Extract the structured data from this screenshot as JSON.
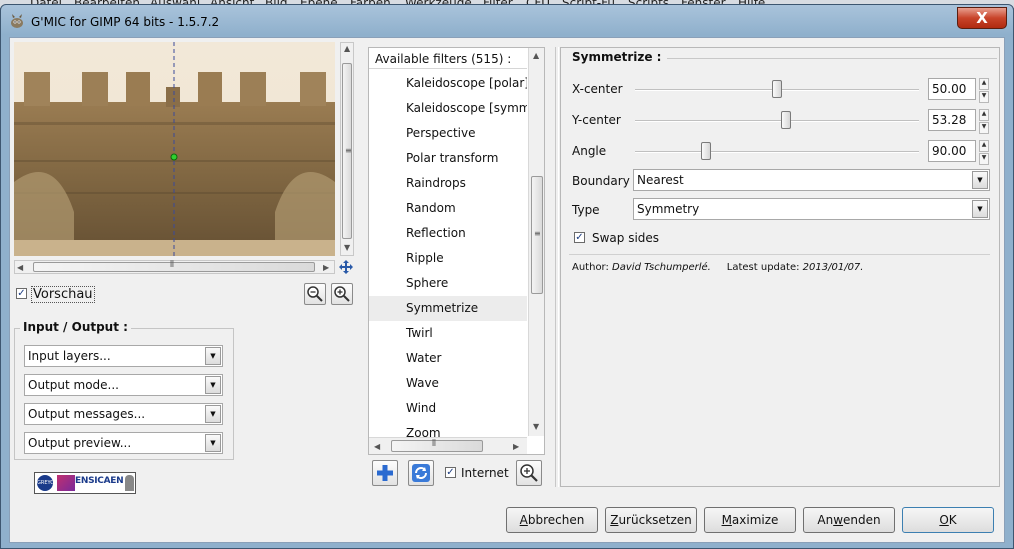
{
  "background_menu": [
    "Datei",
    "Bearbeiten",
    "Auswahl",
    "Ansicht",
    "Bild",
    "Ebene",
    "Farben",
    "Werkzeuge",
    "Filter",
    "CFU",
    "Script-Fu",
    "Scripts",
    "Fenster",
    "Hilfe"
  ],
  "window": {
    "title": "G'MIC for GIMP 64 bits - 1.5.7.2",
    "close_label": "X"
  },
  "preview": {
    "checkbox_label": "Vorschau",
    "checked": true
  },
  "io": {
    "title": "Input / Output :",
    "combos": [
      "Input layers...",
      "Output mode...",
      "Output messages...",
      "Output preview..."
    ]
  },
  "logos": {
    "left": "GREYC",
    "right": "ENSICAEN"
  },
  "filters": {
    "header": "Available filters (515) :",
    "items": [
      "Kaleidoscope [polar]",
      "Kaleidoscope [symmetry]",
      "Perspective",
      "Polar transform",
      "Raindrops",
      "Random",
      "Reflection",
      "Ripple",
      "Sphere",
      "Symmetrize",
      "Twirl",
      "Water",
      "Wave",
      "Wind",
      "Zoom"
    ],
    "selected": "Symmetrize",
    "internet_label": "Internet",
    "internet_checked": true
  },
  "params": {
    "title": "Symmetrize :",
    "sliders": [
      {
        "label": "X-center",
        "value": "50.00",
        "fraction": 0.5
      },
      {
        "label": "Y-center",
        "value": "53.28",
        "fraction": 0.5328
      },
      {
        "label": "Angle",
        "value": "90.00",
        "fraction": 0.25
      }
    ],
    "boundary": {
      "label": "Boundary",
      "value": "Nearest"
    },
    "type": {
      "label": "Type",
      "value": "Symmetry"
    },
    "swap": {
      "label": "Swap sides",
      "checked": true
    },
    "author_label": "Author: ",
    "author": "David Tschumperlé.",
    "update_label": "Latest update: ",
    "update": "2013/01/07."
  },
  "buttons": [
    {
      "pre": "",
      "key": "A",
      "post": "bbrechen"
    },
    {
      "pre": "",
      "key": "Z",
      "post": "urücksetzen"
    },
    {
      "pre": "",
      "key": "M",
      "post": "aximize"
    },
    {
      "pre": "An",
      "key": "w",
      "post": "enden"
    },
    {
      "pre": "",
      "key": "O",
      "post": "K"
    }
  ],
  "colors": {
    "accent": "#1c3c80",
    "title_bg": "#9bb8d3",
    "close": "#c8442a"
  }
}
